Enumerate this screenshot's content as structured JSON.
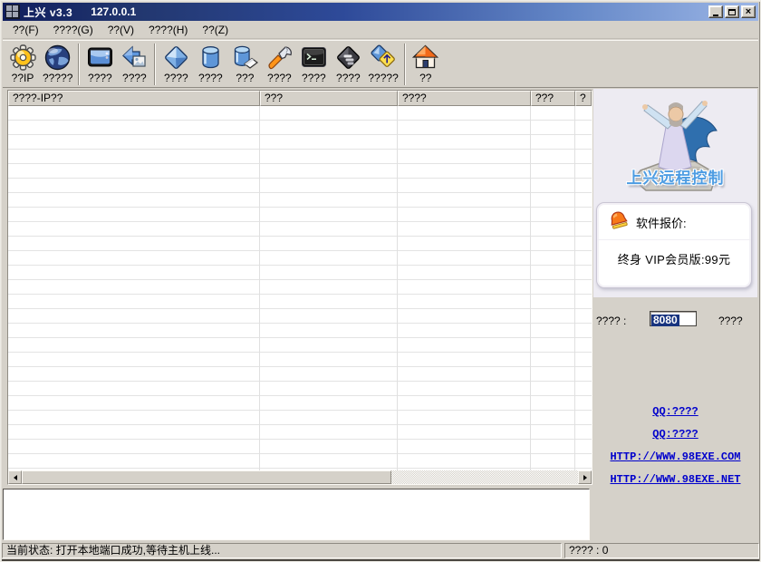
{
  "window": {
    "title": "上兴 v3.3",
    "ip": "127.0.0.1",
    "controls": {
      "minimize": "_",
      "maximize": "□",
      "close": "×"
    }
  },
  "menu": {
    "items": [
      "??(F)",
      "????(G)",
      "??(V)",
      "????(H)",
      "??(Z)"
    ]
  },
  "toolbar": {
    "buttons": [
      {
        "icon": "gear-icon",
        "label": "??IP"
      },
      {
        "icon": "globe-icon",
        "label": "?????"
      },
      {
        "icon": "monitor-icon",
        "label": "????"
      },
      {
        "icon": "back-image-icon",
        "label": "????"
      },
      {
        "icon": "diamond-icon",
        "label": "????"
      },
      {
        "icon": "database-icon",
        "label": "????"
      },
      {
        "icon": "database-clear-icon",
        "label": "???"
      },
      {
        "icon": "wrench-icon",
        "label": "????"
      },
      {
        "icon": "terminal-icon",
        "label": "????"
      },
      {
        "icon": "dark-diamond-icon",
        "label": "????"
      },
      {
        "icon": "diamond-star-icon",
        "label": "?????"
      },
      {
        "icon": "home-icon",
        "label": "??"
      }
    ]
  },
  "table": {
    "columns": [
      "????-IP??",
      "???",
      "????",
      "???",
      "?"
    ]
  },
  "sidebar": {
    "brand_title": "上兴远程控制",
    "price_box": {
      "icon": "bell-icon",
      "title": "软件报价:",
      "price": "终身 VIP会员版:99元"
    },
    "port": {
      "label": "???? :",
      "value": "8080",
      "suffix": "????"
    },
    "links": [
      "QQ:????",
      "QQ:????",
      "HTTP://WWW.98EXE.COM",
      "HTTP://WWW.98EXE.NET"
    ],
    "colors": {
      "brand_blue": "#4d9ce2",
      "link_blue": "#0000cc",
      "selection_navy": "#17337f"
    }
  },
  "statusbar": {
    "left": "当前状态: 打开本地端口成功,等待主机上线...",
    "right": "???? : 0"
  }
}
